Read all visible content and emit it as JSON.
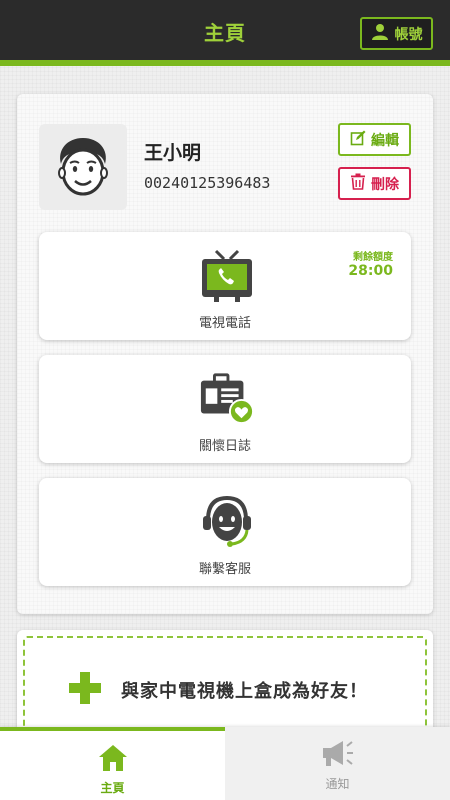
{
  "header": {
    "title": "主頁",
    "account_label": "帳號"
  },
  "profile": {
    "name": "王小明",
    "id": "00240125396483",
    "edit_label": "編輯",
    "delete_label": "刪除"
  },
  "features": [
    {
      "label": "電視電話",
      "icon": "tv-phone-icon",
      "quota_label": "剩餘額度",
      "quota_value": "28:00"
    },
    {
      "label": "關懷日誌",
      "icon": "care-log-icon"
    },
    {
      "label": "聯繫客服",
      "icon": "customer-service-icon"
    }
  ],
  "add_friend": {
    "label": "與家中電視機上盒成為好友！"
  },
  "nav": {
    "home_label": "主頁",
    "notify_label": "通知"
  },
  "colors": {
    "accent": "#7bb81e",
    "danger": "#d6204e",
    "topbar": "#2b2b2b"
  }
}
